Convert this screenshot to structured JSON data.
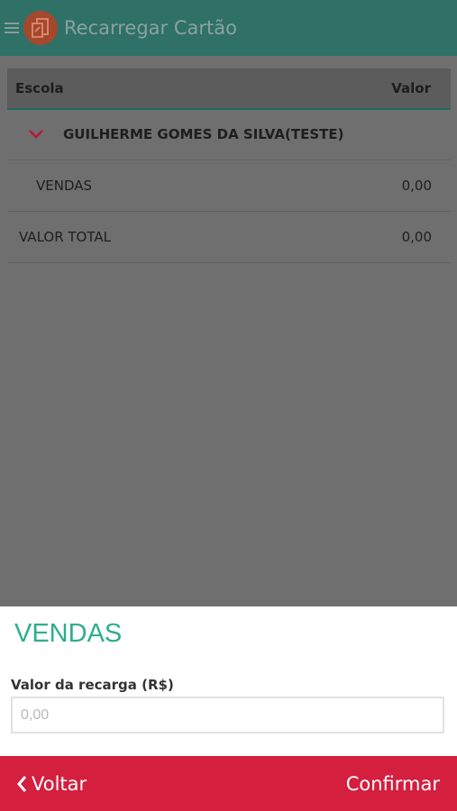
{
  "header": {
    "title": "Recarregar Cartão",
    "menu_icon": "hamburger-icon",
    "logo_icon": "card-logo-icon"
  },
  "table": {
    "columns": [
      "Escola",
      "Valor"
    ],
    "group": {
      "name": "GUILHERME GOMES DA SILVA(TESTE)",
      "icon": "chevron-down-icon",
      "expanded": true
    },
    "rows": [
      {
        "label": "VENDAS",
        "value": "0,00"
      }
    ],
    "total": {
      "label": "VALOR TOTAL",
      "value": "0,00"
    }
  },
  "panel": {
    "title": "VENDAS",
    "field_label": "Valor da recarga (R$)",
    "field_placeholder": "0,00",
    "field_value": ""
  },
  "footer": {
    "back_label": "Voltar",
    "back_icon": "chevron-left-icon",
    "confirm_label": "Confirmar"
  },
  "colors": {
    "header_bg": "#2f7067",
    "accent_green": "#2fae8a",
    "footer_bg": "#d41f3f",
    "chevron": "#b01c35",
    "overlay": "#6f6f6f"
  }
}
